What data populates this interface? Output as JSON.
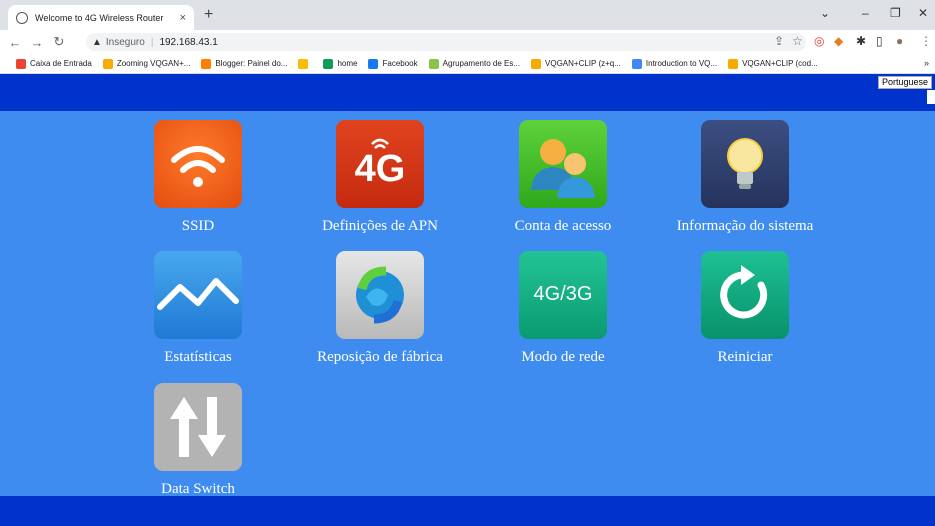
{
  "browser": {
    "tab_title": "Welcome to 4G Wireless Router",
    "tab_close": "×",
    "new_tab": "+",
    "address_warning": "Inseguro",
    "address_url": "192.168.43.1",
    "bookmarks": [
      {
        "label": "Caixa de Entrada",
        "color": "#ea4335"
      },
      {
        "label": "Zooming VQGAN+...",
        "color": "#f9ab00"
      },
      {
        "label": "Blogger: Painel do...",
        "color": "#ff8000"
      },
      {
        "label": "",
        "color": "#fbbc04"
      },
      {
        "label": "home",
        "color": "#0f9d58"
      },
      {
        "label": "Facebook",
        "color": "#1877f2"
      },
      {
        "label": "Agrupamento de Es...",
        "color": "#8bc34a"
      },
      {
        "label": "VQGAN+CLIP (z+q...",
        "color": "#f9ab00"
      },
      {
        "label": "Introduction to VQ...",
        "color": "#4285f4"
      },
      {
        "label": "VQGAN+CLIP (cod...",
        "color": "#f9ab00"
      }
    ],
    "bookmarks_more": "»"
  },
  "page": {
    "language": "Portuguese",
    "tiles": [
      {
        "id": "ssid",
        "label": "SSID"
      },
      {
        "id": "apn",
        "label": "Definições de APN",
        "icon_text": "4G"
      },
      {
        "id": "account",
        "label": "Conta de acesso"
      },
      {
        "id": "sysinfo",
        "label": "Informação do sistema"
      },
      {
        "id": "stats",
        "label": "Estatísticas"
      },
      {
        "id": "factory",
        "label": "Reposição de fábrica"
      },
      {
        "id": "netmode",
        "label": "Modo de rede",
        "icon_text": "4G/3G"
      },
      {
        "id": "reboot",
        "label": "Reiniciar"
      },
      {
        "id": "dataswitch",
        "label": "Data Switch"
      }
    ]
  },
  "colors": {
    "page_bg": "#3f8cf0",
    "bar_bg": "#0033cc"
  }
}
